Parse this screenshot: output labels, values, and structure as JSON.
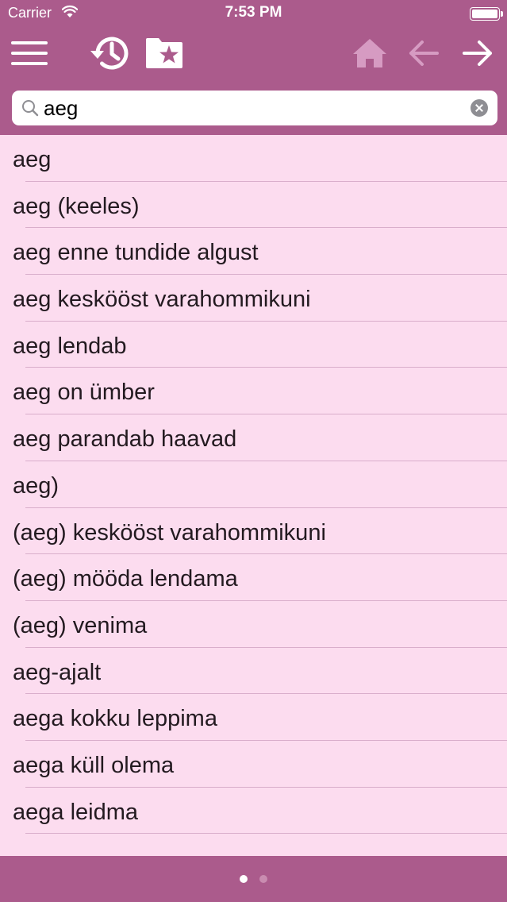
{
  "status_bar": {
    "carrier": "Carrier",
    "time": "7:53 PM"
  },
  "toolbar": {
    "icons": [
      "menu-icon",
      "history-icon",
      "favorites-folder-icon",
      "home-icon",
      "back-arrow-icon",
      "forward-arrow-icon"
    ]
  },
  "search": {
    "value": "aeg",
    "placeholder": ""
  },
  "results": [
    "aeg",
    "aeg (keeles)",
    "aeg enne tundide algust",
    "aeg keskööst varahommikuni",
    "aeg lendab",
    "aeg on ümber",
    "aeg parandab haavad",
    "aeg)",
    "(aeg) keskööst varahommikuni",
    "(aeg) mööda lendama",
    "(aeg) venima",
    "aeg-ajalt",
    "aega kokku leppima",
    "aega küll olema",
    "aega leidma"
  ],
  "pager": {
    "pages": 2,
    "current": 1
  },
  "colors": {
    "bar": "#ab5b8c",
    "list_bg": "#fcdcef",
    "separator": "#d9aecb",
    "disabled_icon": "#d69bc2"
  }
}
